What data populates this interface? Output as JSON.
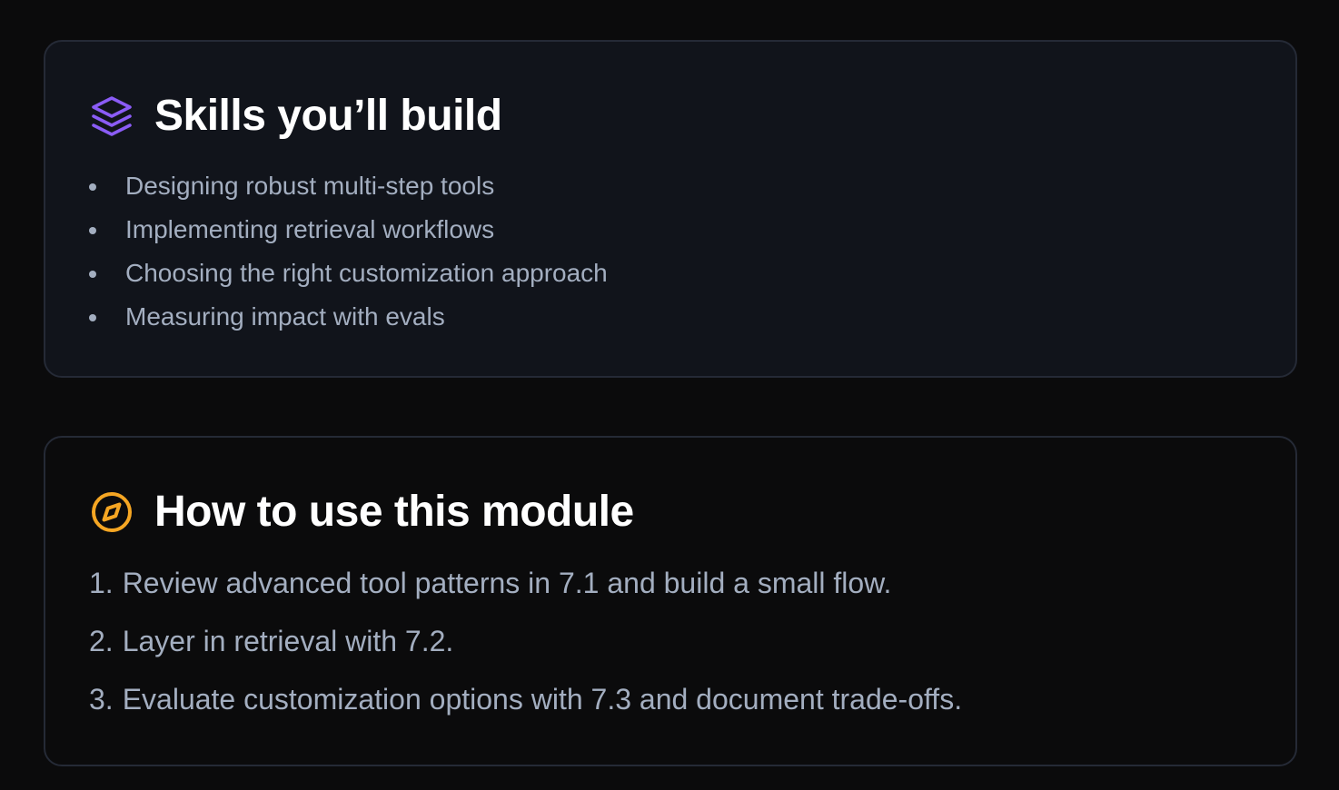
{
  "skills_card": {
    "icon": "layers-icon",
    "title": "Skills you’ll build",
    "items": [
      "Designing robust multi-step tools",
      "Implementing retrieval workflows",
      "Choosing the right customization approach",
      "Measuring impact with evals"
    ]
  },
  "howto_card": {
    "icon": "compass-icon",
    "title": "How to use this module",
    "steps": [
      {
        "number": "1.",
        "text": "Review advanced tool patterns in 7.1 and build a small flow."
      },
      {
        "number": "2.",
        "text": "Layer in retrieval with 7.2."
      },
      {
        "number": "3.",
        "text": "Evaluate customization options with 7.3 and document trade-offs."
      }
    ]
  },
  "colors": {
    "background": "#0b0b0c",
    "card_background": "#11141b",
    "card_border": "#252a36",
    "title": "#ffffff",
    "body_text": "#a3aec0",
    "layers_icon": "#8b5cf6",
    "compass_icon": "#f5a623"
  }
}
